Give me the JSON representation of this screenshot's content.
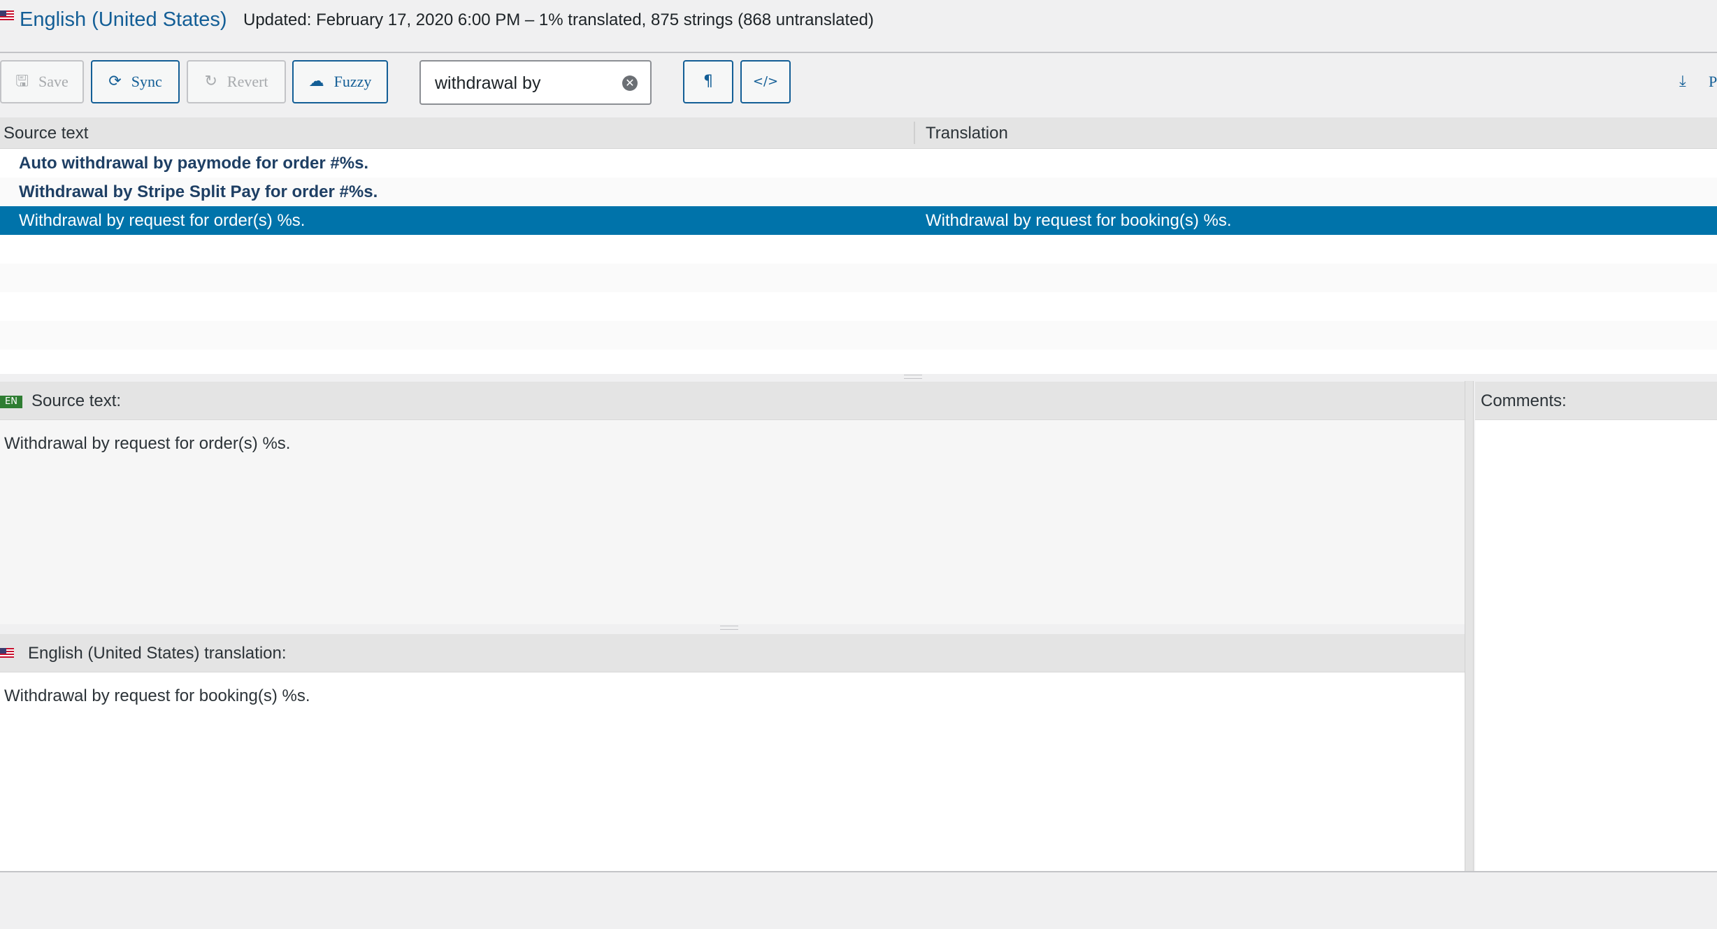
{
  "header": {
    "language_title": "English (United States)",
    "updated_text": "Updated: February 17, 2020 6:00 PM – 1% translated, 875 strings (868 untranslated)"
  },
  "toolbar": {
    "save_label": "Save",
    "sync_label": "Sync",
    "revert_label": "Revert",
    "fuzzy_label": "Fuzzy",
    "search_value": "withdrawal by",
    "invisibles_glyph": "¶",
    "code_glyph": "</>",
    "download_label": "P"
  },
  "list": {
    "col_source": "Source text",
    "col_translation": "Translation",
    "rows": [
      {
        "source": "Auto withdrawal by paymode for order #%s.",
        "translation": ""
      },
      {
        "source": "Withdrawal by Stripe Split Pay for order #%s.",
        "translation": ""
      },
      {
        "source": "Withdrawal by request for order(s) %s.",
        "translation": "Withdrawal by request for booking(s) %s."
      }
    ]
  },
  "editor": {
    "source_badge": "EN",
    "source_label": "Source text:",
    "source_text": "Withdrawal by request for order(s) %s.",
    "translation_label": "English (United States) translation:",
    "translation_text": "Withdrawal by request for booking(s) %s.",
    "comments_label": "Comments:"
  },
  "colors": {
    "accent": "#135e96",
    "selected_row": "#0073aa",
    "untranslated_text": "#1e3f64",
    "badge_green": "#2e7d32"
  },
  "icons": [
    "flag-us-icon",
    "save-icon",
    "sync-icon",
    "revert-icon",
    "cloud-icon",
    "clear-icon",
    "pilcrow-icon",
    "code-icon",
    "download-icon"
  ]
}
